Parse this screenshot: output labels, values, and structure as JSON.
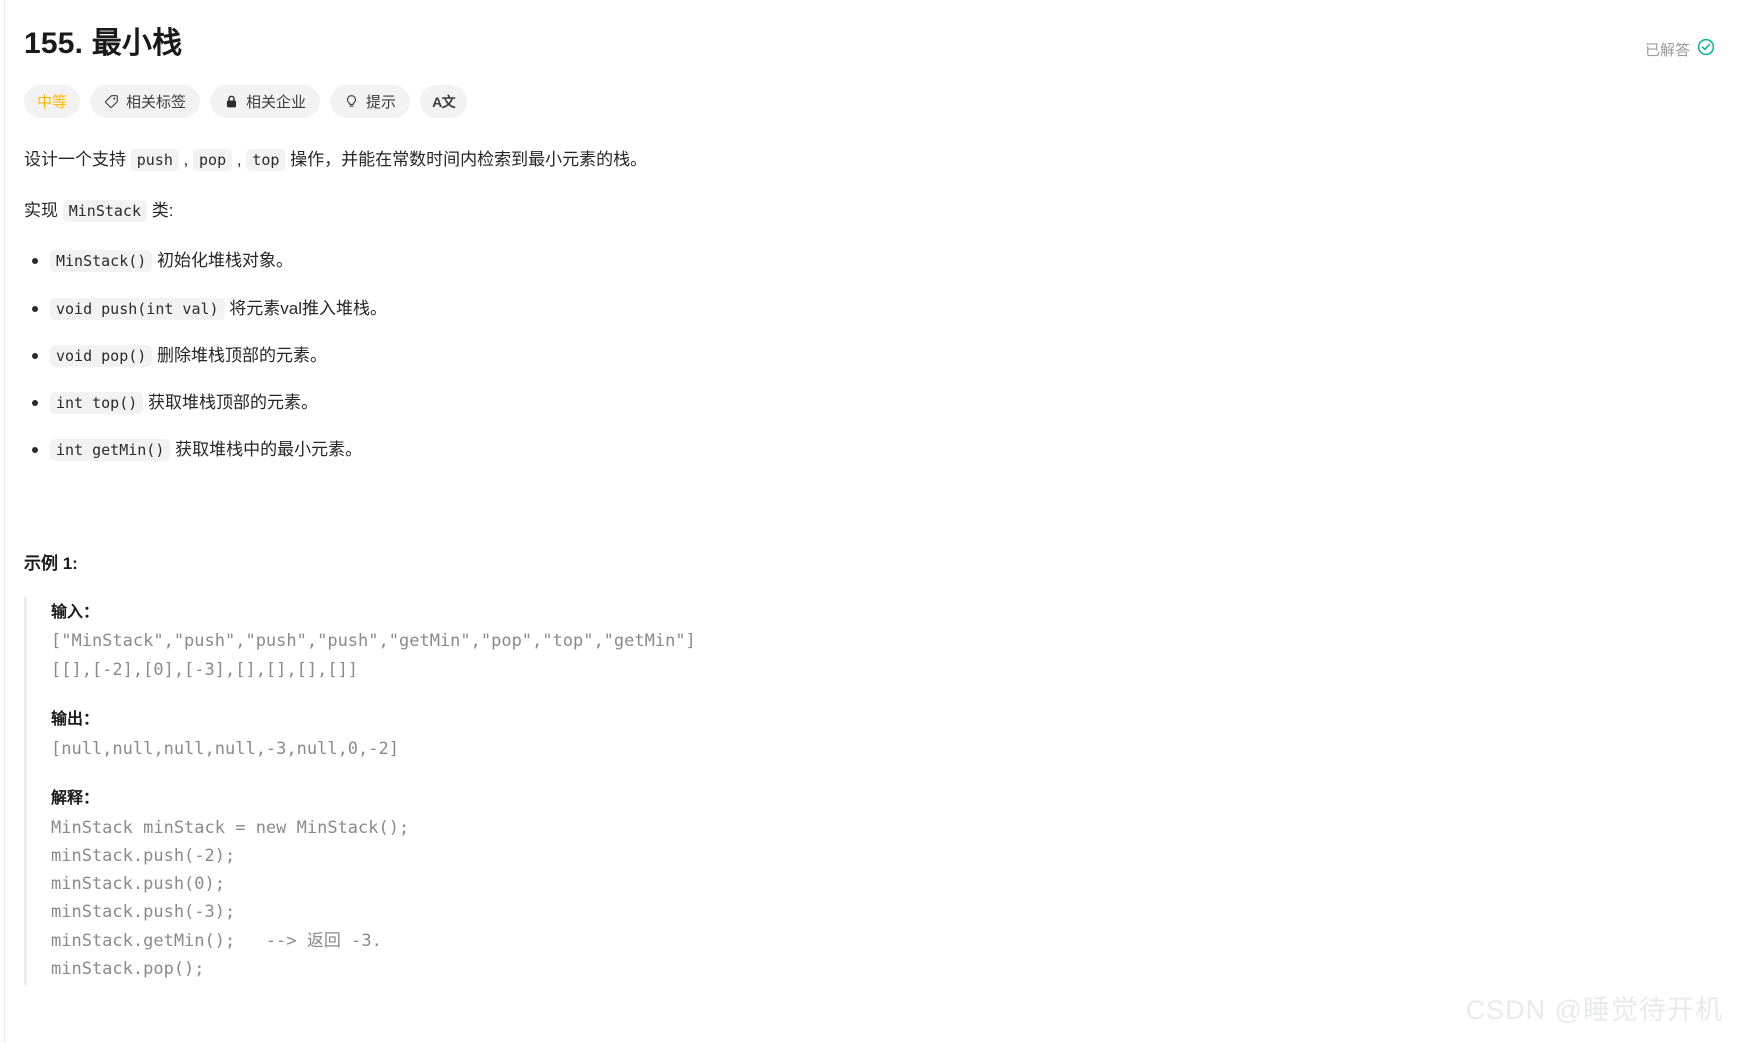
{
  "problem": {
    "title": "155. 最小栈",
    "status_label": "已解答",
    "status_icon": "check-circle-icon",
    "status_color": "#00af9b"
  },
  "pills": [
    {
      "label": "中等",
      "icon": null,
      "name": "difficulty-badge",
      "color": "#ffb800"
    },
    {
      "label": "相关标签",
      "icon": "tag-icon",
      "name": "related-tags-button"
    },
    {
      "label": "相关企业",
      "icon": "lock-icon",
      "name": "related-companies-button"
    },
    {
      "label": "提示",
      "icon": "lightbulb-icon",
      "name": "hints-button"
    },
    {
      "label": "A文",
      "icon": "translate-icon",
      "name": "language-toggle-button"
    }
  ],
  "description": {
    "line1_prefix": "设计一个支持 ",
    "code_push": "push",
    "sep1": " , ",
    "code_pop": "pop",
    "sep2": " , ",
    "code_top": "top",
    "line1_suffix": " 操作，并能在常数时间内检索到最小元素的栈。",
    "line2_prefix": "实现 ",
    "code_minstack": "MinStack",
    "line2_suffix": " 类:"
  },
  "methods": [
    {
      "code": "MinStack()",
      "text": " 初始化堆栈对象。"
    },
    {
      "code": "void push(int val)",
      "text": " 将元素val推入堆栈。"
    },
    {
      "code": "void pop()",
      "text": " 删除堆栈顶部的元素。"
    },
    {
      "code": "int top()",
      "text": " 获取堆栈顶部的元素。"
    },
    {
      "code": "int getMin()",
      "text": " 获取堆栈中的最小元素。"
    }
  ],
  "example": {
    "heading": "示例 1:",
    "input_label": "输入：",
    "input_code": "[\"MinStack\",\"push\",\"push\",\"push\",\"getMin\",\"pop\",\"top\",\"getMin\"]\n[[],[-2],[0],[-3],[],[],[],[]]",
    "output_label": "输出：",
    "output_code": "[null,null,null,null,-3,null,0,-2]",
    "explain_label": "解释：",
    "explain_code": "MinStack minStack = new MinStack();\nminStack.push(-2);\nminStack.push(0);\nminStack.push(-3);\nminStack.getMin();   --> 返回 -3.\nminStack.pop();"
  },
  "watermark": {
    "text": "CSDN @睡觉待开机"
  }
}
